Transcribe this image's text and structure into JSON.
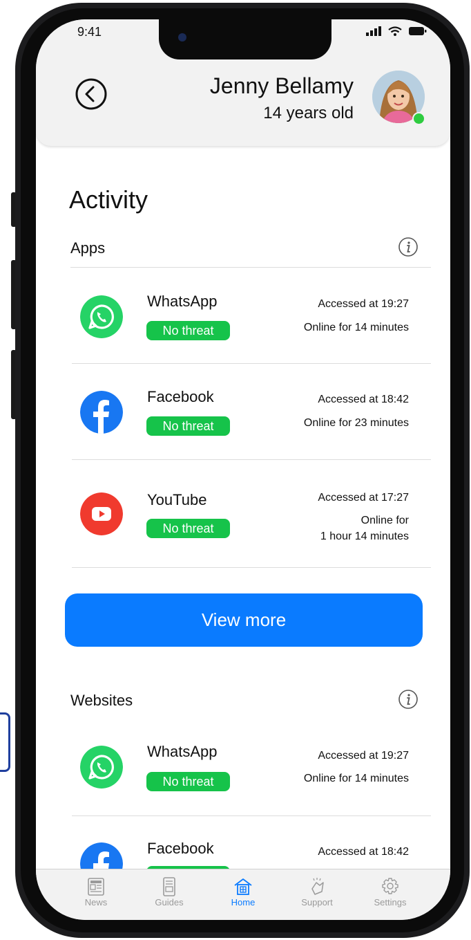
{
  "status_bar": {
    "time": "9:41"
  },
  "header": {
    "name": "Jenny Bellamy",
    "age": "14 years old",
    "online": true
  },
  "activity": {
    "title": "Activity",
    "apps": {
      "title": "Apps",
      "items": [
        {
          "name": "WhatsApp",
          "icon": "whatsapp-icon",
          "badge": "No threat",
          "accessed": "Accessed at 19:27",
          "online_lines": [
            "Online for 14 minutes"
          ]
        },
        {
          "name": "Facebook",
          "icon": "facebook-icon",
          "badge": "No threat",
          "accessed": "Accessed at 18:42",
          "online_lines": [
            "Online for 23 minutes"
          ]
        },
        {
          "name": "YouTube",
          "icon": "youtube-icon",
          "badge": "No threat",
          "accessed": "Accessed at 17:27",
          "online_lines": [
            "Online for",
            "1 hour 14 minutes"
          ]
        }
      ],
      "view_more": "View more"
    },
    "websites": {
      "title": "Websites",
      "items": [
        {
          "name": "WhatsApp",
          "icon": "whatsapp-icon",
          "badge": "No threat",
          "accessed": "Accessed at 19:27",
          "online_lines": [
            "Online for 14 minutes"
          ]
        },
        {
          "name": "Facebook",
          "icon": "facebook-icon",
          "badge": "No threat",
          "accessed": "Accessed at 18:42",
          "online_lines": []
        }
      ]
    }
  },
  "tabbar": {
    "tabs": [
      {
        "label": "News",
        "icon": "newspaper-icon",
        "active": false
      },
      {
        "label": "Guides",
        "icon": "guide-book-icon",
        "active": false
      },
      {
        "label": "Home",
        "icon": "home-icon",
        "active": true
      },
      {
        "label": "Support",
        "icon": "support-icon",
        "active": false
      },
      {
        "label": "Settings",
        "icon": "gear-icon",
        "active": false
      }
    ]
  },
  "colors": {
    "accent": "#0a7bff",
    "badge_green": "#16c34a",
    "whatsapp": "#25d366",
    "facebook": "#1877f2",
    "youtube": "#f03a2e",
    "header_bg": "#f2f2f2"
  }
}
